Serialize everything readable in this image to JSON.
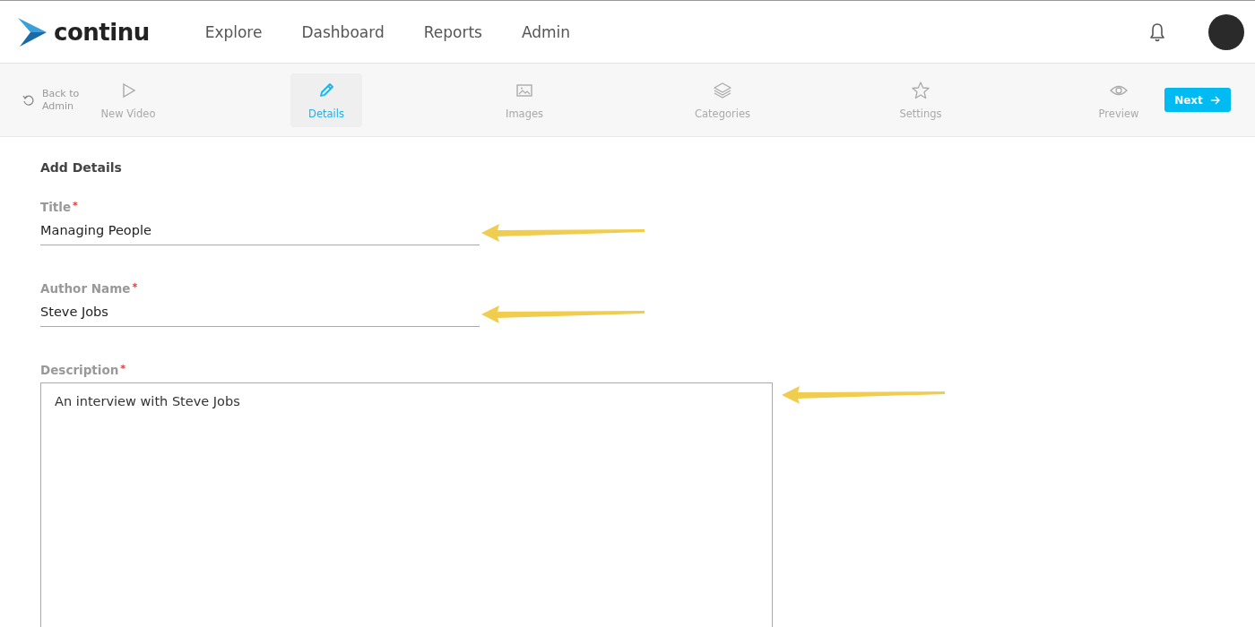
{
  "header": {
    "logo_text": "continu",
    "nav": [
      {
        "label": "Explore"
      },
      {
        "label": "Dashboard"
      },
      {
        "label": "Reports"
      },
      {
        "label": "Admin"
      }
    ]
  },
  "stepbar": {
    "back": {
      "label": "Back to Admin"
    },
    "steps": [
      {
        "kind": "play",
        "label": "New Video",
        "selected": false
      },
      {
        "kind": "pencil",
        "label": "Details",
        "selected": true
      },
      {
        "kind": "image",
        "label": "Images",
        "selected": false
      },
      {
        "kind": "layers",
        "label": "Categories",
        "selected": false
      },
      {
        "kind": "star",
        "label": "Settings",
        "selected": false
      },
      {
        "kind": "eye",
        "label": "Preview",
        "selected": false
      }
    ],
    "next_button": "Next"
  },
  "form": {
    "heading": "Add Details",
    "fields": [
      {
        "kind": "line",
        "label": "Title",
        "required_mark": "*",
        "value": "Managing People",
        "arrow": true
      },
      {
        "kind": "line",
        "label": "Author Name",
        "required_mark": "*",
        "value": "Steve Jobs",
        "arrow": true
      },
      {
        "kind": "area",
        "label": "Description",
        "required_mark": "*",
        "value": "An interview with Steve Jobs",
        "arrow": true
      }
    ]
  }
}
